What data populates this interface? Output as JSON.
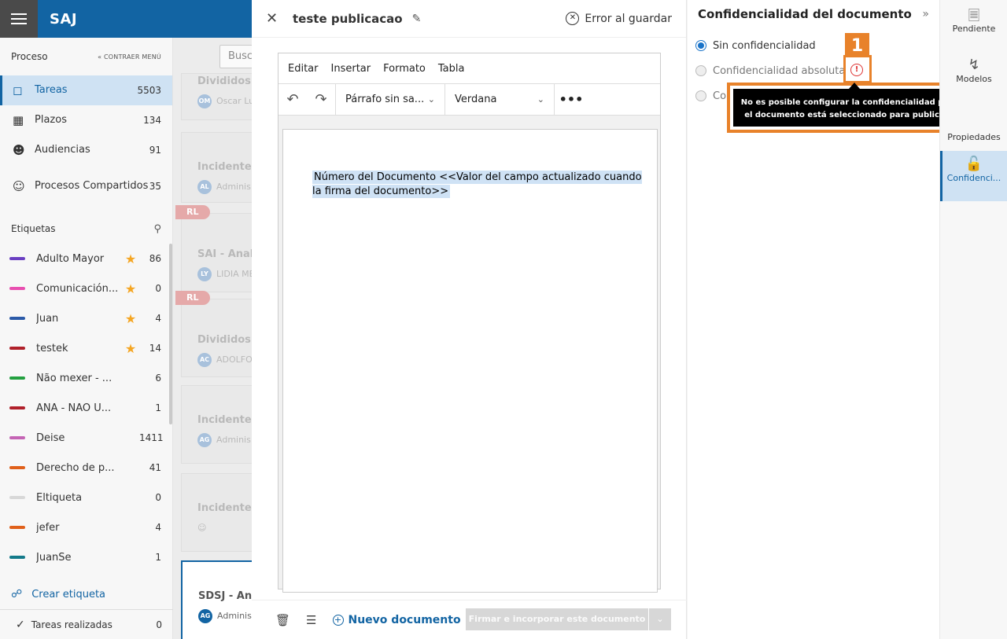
{
  "app": {
    "brand": "SAJ"
  },
  "sidebar": {
    "section_title": "Proceso",
    "collapse_label": "« CONTRAER MENÚ",
    "nav": [
      {
        "label": "Tareas",
        "count": "5503"
      },
      {
        "label": "Plazos",
        "count": "134"
      },
      {
        "label": "Audiencias",
        "count": "91"
      },
      {
        "label": "Procesos Compartidos",
        "count": "35"
      }
    ],
    "tags_title": "Etiquetas",
    "tags": [
      {
        "label": "Adulto Mayor",
        "count": "86",
        "color": "#6a3fc2",
        "starred": true
      },
      {
        "label": "Comunicación...",
        "count": "0",
        "color": "#e84fb0",
        "starred": true
      },
      {
        "label": "Juan",
        "count": "4",
        "color": "#2b5aa8",
        "starred": true
      },
      {
        "label": "testek",
        "count": "14",
        "color": "#b0202a",
        "starred": true
      },
      {
        "label": "Não mexer - ...",
        "count": "6",
        "color": "#23a040",
        "starred": false
      },
      {
        "label": "ANA - NÃO U...",
        "count": "1",
        "color": "#b0202a",
        "starred": false
      },
      {
        "label": "Deise",
        "count": "1411",
        "color": "#c464b4",
        "starred": false
      },
      {
        "label": "Derecho de p...",
        "count": "41",
        "color": "#e0601a",
        "starred": false
      },
      {
        "label": "Eltiqueta",
        "count": "0",
        "color": "#d8d8d8",
        "starred": false
      },
      {
        "label": "jefer",
        "count": "4",
        "color": "#e0601a",
        "starred": false
      },
      {
        "label": "JuanSe",
        "count": "1",
        "color": "#147a8a",
        "starred": false
      }
    ],
    "create_tag": "Crear etiqueta",
    "done_label": "Tareas realizadas",
    "done_count": "0"
  },
  "tasks": {
    "search_placeholder": "Busc",
    "cards": [
      {
        "title": "Divididos",
        "avatar": "OM",
        "who": "Oscar Lu"
      },
      {
        "title": "Incidentes",
        "avatar": "AL",
        "who": "Adminis"
      },
      {
        "title": "SAI - Anali",
        "avatar": "LY",
        "who": "LIDIA ME",
        "badge": "RL"
      },
      {
        "title": "Divididos",
        "avatar": "AC",
        "who": "ADOLFO",
        "badge": "RL"
      },
      {
        "title": "Incidentes",
        "avatar": "AG",
        "who": "Adminis"
      },
      {
        "title": "Incidentes",
        "avatar": "",
        "who": ""
      },
      {
        "title": "SDSJ - Ana",
        "avatar": "AG",
        "who": "Adminis"
      }
    ]
  },
  "editor": {
    "title": "teste publicacao",
    "error_label": "Error al guardar",
    "menu": [
      "Editar",
      "Insertar",
      "Formato",
      "Tabla"
    ],
    "paragraph_style": "Párrafo sin sa...",
    "font": "Verdana",
    "body_text": "Número del Documento <<Valor del campo actualizado cuando la firma del documento>>",
    "new_doc_label": "Nuevo documento",
    "sign_label": "Firmar e incorporar este documento"
  },
  "panel": {
    "title": "Confidencialidad del documento",
    "options": [
      {
        "label": "Sin confidencialidad",
        "selected": true
      },
      {
        "label": "Confidencialidad absoluta",
        "selected": false
      },
      {
        "label": "Co",
        "selected": false
      }
    ],
    "callout_number": "1",
    "tooltip": "No es posible configurar la confidencialidad porque el documento está seleccionado para publicación."
  },
  "rail": [
    {
      "label": "Pendiente",
      "icon": "doc-clock-icon"
    },
    {
      "label": "Modelos",
      "icon": "lightning-icon"
    },
    {
      "label": "Propiedades",
      "icon": "properties-icon"
    },
    {
      "label": "Confidenci...",
      "icon": "lock-icon",
      "active": true
    }
  ]
}
